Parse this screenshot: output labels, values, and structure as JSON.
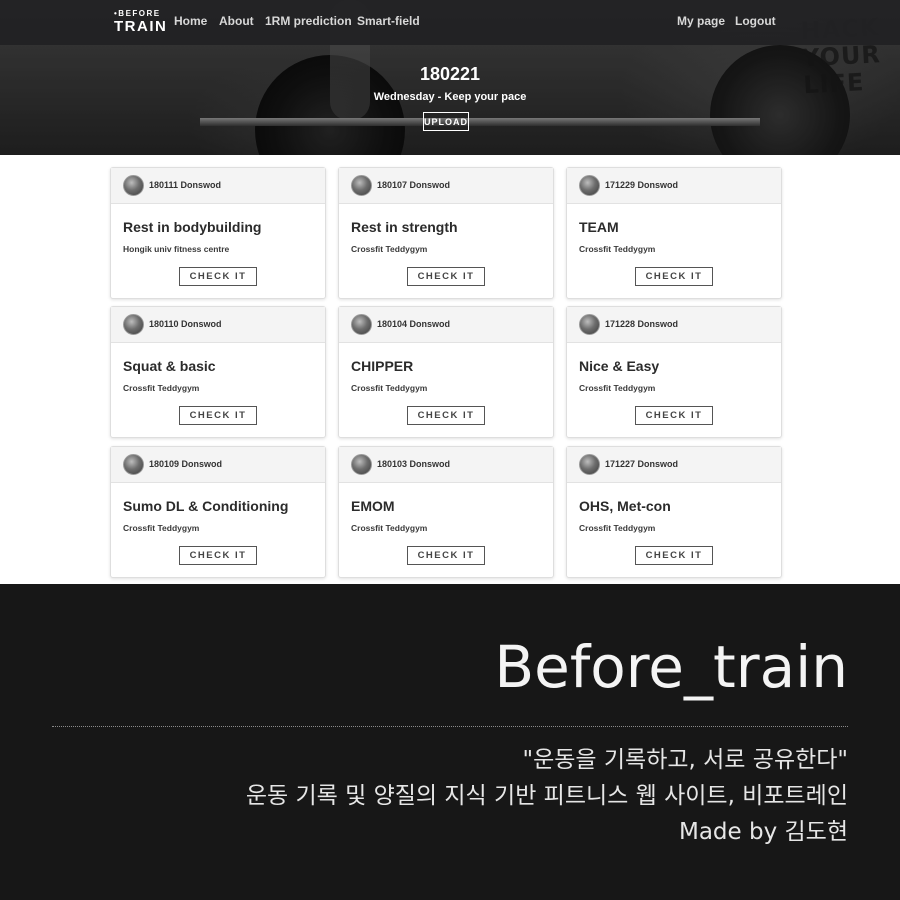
{
  "navbar": {
    "logo_top": "•BEFORE",
    "logo_bottom": "TRAIN",
    "links": [
      "Home",
      "About",
      "1RM prediction",
      "Smart-field"
    ],
    "right_links": [
      "My page",
      "Logout"
    ]
  },
  "hero": {
    "date": "180221",
    "subtitle": "Wednesday - Keep your pace",
    "upload_label": "UPLOAD",
    "background_lettering": "HACK\nYOUR\nLIFE"
  },
  "cards": [
    {
      "author": "180111 Donswod",
      "title": "Rest in bodybuilding",
      "gym": "Hongik univ fitness centre",
      "button": "CHECK IT"
    },
    {
      "author": "180107 Donswod",
      "title": "Rest in strength",
      "gym": "Crossfit Teddygym",
      "button": "CHECK IT"
    },
    {
      "author": "171229 Donswod",
      "title": "TEAM",
      "gym": "Crossfit Teddygym",
      "button": "CHECK IT"
    },
    {
      "author": "180110 Donswod",
      "title": "Squat & basic",
      "gym": "Crossfit Teddygym",
      "button": "CHECK IT"
    },
    {
      "author": "180104 Donswod",
      "title": "CHIPPER",
      "gym": "Crossfit Teddygym",
      "button": "CHECK IT"
    },
    {
      "author": "171228 Donswod",
      "title": "Nice & Easy",
      "gym": "Crossfit Teddygym",
      "button": "CHECK IT"
    },
    {
      "author": "180109 Donswod",
      "title": "Sumo DL & Conditioning",
      "gym": "Crossfit Teddygym",
      "button": "CHECK IT"
    },
    {
      "author": "180103 Donswod",
      "title": "EMOM",
      "gym": "Crossfit Teddygym",
      "button": "CHECK IT"
    },
    {
      "author": "171227 Donswod",
      "title": "OHS, Met-con",
      "gym": "Crossfit Teddygym",
      "button": "CHECK IT"
    }
  ],
  "caption": {
    "title": "Before_train",
    "line1": "\"운동을 기록하고, 서로 공유한다\"",
    "line2": "운동 기록 및 양질의 지식 기반 피트니스 웹 사이트, 비포트레인",
    "line3": "Made by 김도현"
  },
  "colors": {
    "navbar_bg": "#212123",
    "caption_bg": "#171717",
    "card_header_bg": "#f4f4f4"
  }
}
